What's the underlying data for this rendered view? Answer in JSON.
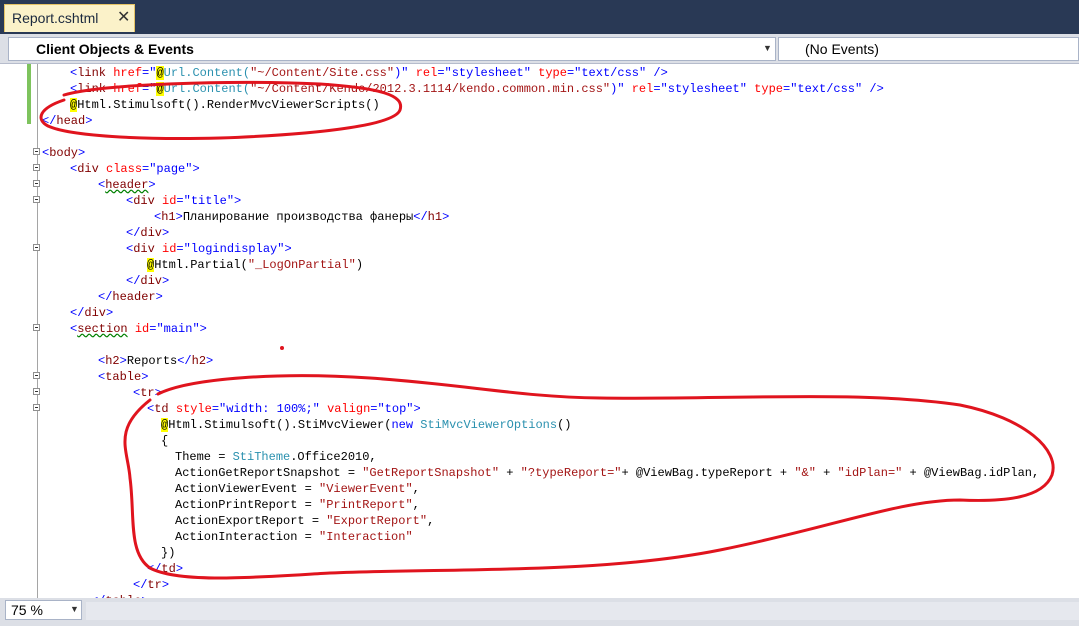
{
  "tab": {
    "title": "Report.cshtml",
    "close_glyph": "✕"
  },
  "navbar": {
    "objects_label": "Client Objects & Events",
    "events_label": "(No Events)",
    "dropdown_glyph": "▼"
  },
  "status": {
    "zoom": "75 %",
    "dropdown_glyph": "▼"
  },
  "colors": {
    "tag": "#800000",
    "attribute": "#ff0000",
    "string": "#0000ff",
    "razor_bg": "#ffff00",
    "type": "#2b91af",
    "annotation": "#e0141e"
  },
  "code": {
    "l1": [
      "<",
      "link",
      " ",
      "href",
      "=\"",
      "@",
      "Url.Content(",
      "\"~/Content/Site.css\"",
      ")\"",
      " ",
      "rel",
      "=",
      "\"stylesheet\"",
      " ",
      "type",
      "=",
      "\"text/css\"",
      " />"
    ],
    "l2": [
      "<",
      "link",
      " ",
      "href",
      "=\"",
      "@",
      "Url.Content(",
      "\"~/Content/Kendo/2012.3.1114/kendo.common.min.css\"",
      ")\"",
      " ",
      "rel",
      "=",
      "\"stylesheet\"",
      " ",
      "type",
      "=",
      "\"text/css\"",
      " />"
    ],
    "l3": [
      "@",
      "Html.Stimulsoft().RenderMvcViewerScripts()"
    ],
    "l4": [
      "</",
      "head",
      ">"
    ],
    "l6": [
      "<",
      "body",
      ">"
    ],
    "l7": [
      "<",
      "div",
      " ",
      "class",
      "=",
      "\"page\"",
      ">"
    ],
    "l8": [
      "<",
      "header",
      ">"
    ],
    "l9": [
      "<",
      "div",
      " ",
      "id",
      "=",
      "\"title\"",
      ">"
    ],
    "l10": [
      "<",
      "h1",
      ">",
      "Планирование производства фанеры",
      "</",
      "h1",
      ">"
    ],
    "l11": [
      "</",
      "div",
      ">"
    ],
    "l12": [
      "<",
      "div",
      " ",
      "id",
      "=",
      "\"logindisplay\"",
      ">"
    ],
    "l13": [
      "@",
      "Html.Partial(",
      "\"_LogOnPartial\"",
      ")"
    ],
    "l14": [
      "</",
      "div",
      ">"
    ],
    "l15": [
      "</",
      "header",
      ">"
    ],
    "l16": [
      "</",
      "div",
      ">"
    ],
    "l17": [
      "<",
      "section",
      " ",
      "id",
      "=",
      "\"main\"",
      ">"
    ],
    "l19": [
      "<",
      "h2",
      ">",
      "Reports",
      "</",
      "h2",
      ">"
    ],
    "l20": [
      "<",
      "table",
      ">"
    ],
    "l21": [
      "<",
      "tr",
      ">"
    ],
    "l22": [
      "<",
      "td",
      " ",
      "style",
      "=",
      "\"width: 100%;\"",
      " ",
      "valign",
      "=",
      "\"top\"",
      ">"
    ],
    "l23": [
      "@",
      "Html.Stimulsoft().StiMvcViewer(",
      "new",
      " ",
      "StiMvcViewerOptions",
      "()"
    ],
    "l24": [
      "{"
    ],
    "l25": [
      "Theme = ",
      "StiTheme",
      ".Office2010,"
    ],
    "l26": [
      "ActionGetReportSnapshot = ",
      "\"GetReportSnapshot\"",
      " + ",
      "\"?typeReport=\"",
      "+ @ViewBag.typeReport + ",
      "\"&\"",
      " + ",
      "\"idPlan=\"",
      " + @ViewBag.idPlan,"
    ],
    "l27": [
      "ActionViewerEvent = ",
      "\"ViewerEvent\"",
      ","
    ],
    "l28": [
      "ActionPrintReport = ",
      "\"PrintReport\"",
      ","
    ],
    "l29": [
      "ActionExportReport = ",
      "\"ExportReport\"",
      ","
    ],
    "l30": [
      "ActionInteraction = ",
      "\"Interaction\""
    ],
    "l31": [
      "})"
    ],
    "l32": [
      "</",
      "td",
      ">"
    ],
    "l33": [
      "</",
      "tr",
      ">"
    ],
    "l34": [
      "</",
      "table",
      ">"
    ]
  }
}
